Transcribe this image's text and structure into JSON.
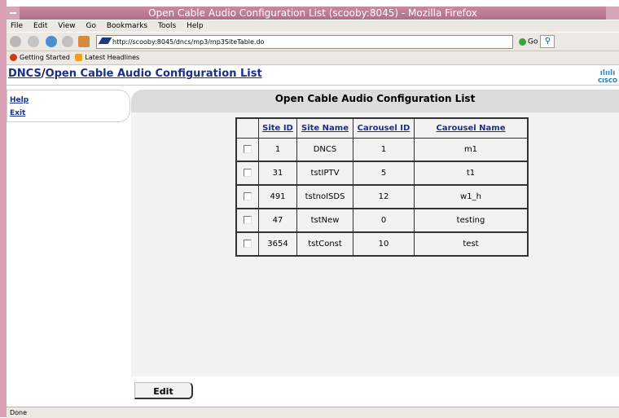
{
  "window": {
    "title": "Open Cable Audio Configuration List (scooby:8045) - Mozilla Firefox"
  },
  "menu": [
    "File",
    "Edit",
    "View",
    "Go",
    "Bookmarks",
    "Tools",
    "Help"
  ],
  "address": {
    "url": "http://scooby:8045/dncs/mp3/mp3SiteTable.do",
    "go_label": "Go"
  },
  "bookmarks": [
    "Getting Started",
    "Latest Headlines"
  ],
  "header": {
    "root": "DNCS",
    "separator": "/",
    "title": "Open Cable Audio Configuration List",
    "logo_text": "CISCO"
  },
  "leftnav": {
    "help": "Help",
    "exit": "Exit"
  },
  "panel": {
    "title": "Open Cable Audio Configuration List"
  },
  "table": {
    "columns": [
      "Site ID",
      "Site Name",
      "Carousel ID",
      "Carousel Name"
    ],
    "rows": [
      {
        "site_id": "1",
        "site_name": "DNCS",
        "carousel_id": "1",
        "carousel_name": "m1"
      },
      {
        "site_id": "31",
        "site_name": "tstIPTV",
        "carousel_id": "5",
        "carousel_name": "t1"
      },
      {
        "site_id": "491",
        "site_name": "tstnoISDS",
        "carousel_id": "12",
        "carousel_name": "w1_h"
      },
      {
        "site_id": "47",
        "site_name": "tstNew",
        "carousel_id": "0",
        "carousel_name": "testing"
      },
      {
        "site_id": "3654",
        "site_name": "tstConst",
        "carousel_id": "10",
        "carousel_name": "test"
      }
    ]
  },
  "actions": {
    "edit_label": "Edit"
  },
  "status": {
    "text": "Done"
  },
  "colors": {
    "link": "#1a2f8a",
    "titlebar": "#b06f88",
    "panel": "#f2f2f2"
  }
}
